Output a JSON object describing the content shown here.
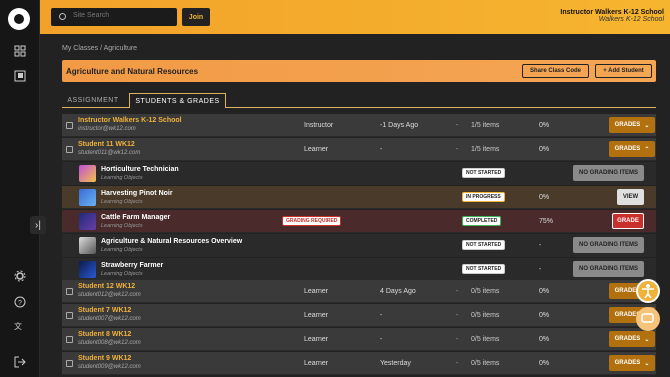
{
  "topbar": {
    "search_placeholder": "Site Search",
    "join": "Join",
    "school": "Instructor Walkers K-12 School",
    "school_sub": "Walkers K-12 School"
  },
  "breadcrumb": "My Classes  /  Agriculture",
  "banner": {
    "title": "Agriculture and Natural Resources",
    "share": "Share Class Code",
    "add": "+ Add Student"
  },
  "tabs": {
    "assignment": "ASSIGNMENT",
    "students": "STUDENTS & GRADES"
  },
  "rows": {
    "r0": {
      "name": "Instructor Walkers K-12 School",
      "email": "instructor@wk12.com",
      "role": "Instructor",
      "last": "-1 Days Ago",
      "dash": "-",
      "items": "1/5 items",
      "pct": "0%",
      "btn": "GRADES"
    },
    "r1": {
      "name": "Student 11 WK12",
      "email": "student011@wk12.com",
      "role": "Learner",
      "last": "-",
      "dash": "-",
      "items": "1/5 items",
      "pct": "0%",
      "btn": "GRADES"
    },
    "r7": {
      "name": "Student 12 WK12",
      "email": "student012@wk12.com",
      "role": "Learner",
      "last": "4 Days Ago",
      "dash": "-",
      "items": "0/5 items",
      "pct": "0%",
      "btn": "GRADES"
    },
    "r8": {
      "name": "Student 7 WK12",
      "email": "student007@wk12.com",
      "role": "Learner",
      "last": "-",
      "dash": "-",
      "items": "0/5 items",
      "pct": "0%",
      "btn": "GRADES"
    },
    "r9": {
      "name": "Student 8 WK12",
      "email": "student008@wk12.com",
      "role": "Learner",
      "last": "-",
      "dash": "-",
      "items": "0/5 items",
      "pct": "0%",
      "btn": "GRADES"
    },
    "r10": {
      "name": "Student 9 WK12",
      "email": "student009@wk12.com",
      "role": "Learner",
      "last": "Yesterday",
      "dash": "-",
      "items": "0/5 items",
      "pct": "0%",
      "btn": "GRADES"
    }
  },
  "lo": {
    "a": {
      "name": "Horticulture Technician",
      "sub": "Learning Objects",
      "status": "NOT STARTED",
      "btn": "NO GRADING ITEMS"
    },
    "b": {
      "name": "Harvesting Pinot Noir",
      "sub": "Learning Objects",
      "status": "IN PROGRESS",
      "pct": "0%",
      "btn": "VIEW"
    },
    "c": {
      "name": "Cattle Farm Manager",
      "sub": "Learning Objects",
      "req": "GRADING REQUIRED",
      "status": "COMPLETED",
      "pct": "75%",
      "btn": "GRADE"
    },
    "d": {
      "name": "Agriculture & Natural Resources Overview",
      "sub": "Learning Objects",
      "status": "NOT STARTED",
      "pct": "-",
      "btn": "NO GRADING ITEMS"
    },
    "e": {
      "name": "Strawberry Farmer",
      "sub": "Learning Objects",
      "status": "NOT STARTED",
      "pct": "-",
      "btn": "NO GRADING ITEMS"
    }
  }
}
